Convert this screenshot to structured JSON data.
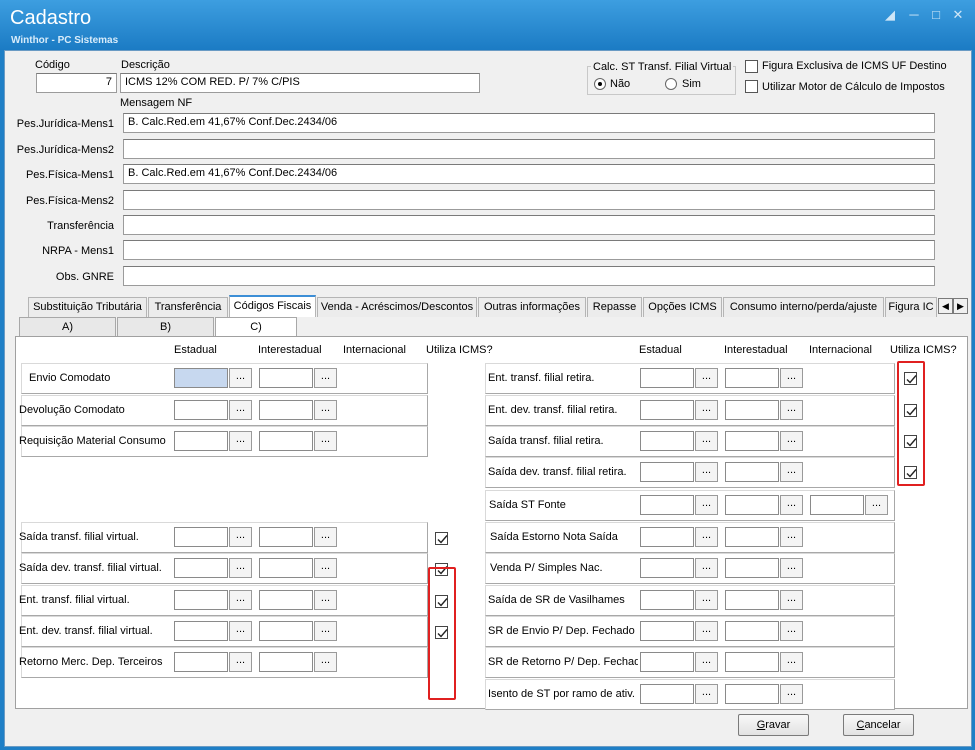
{
  "window": {
    "title": "Cadastro",
    "subtitle": "Winthor - PC Sistemas"
  },
  "header": {
    "codigo_label": "Código",
    "codigo_value": "7",
    "descricao_label": "Descrição",
    "descricao_value": "ICMS 12% COM RED. P/ 7% C/PIS",
    "calc_st_label": "Calc. ST Transf. Filial Virtual",
    "radio_nao": "Não",
    "radio_sim": "Sim",
    "figura_exclusiva": "Figura Exclusiva de ICMS UF Destino",
    "utilizar_motor": "Utilizar Motor de Cálculo de Impostos",
    "mensagem_nf_label": "Mensagem NF"
  },
  "messages": [
    {
      "label": "Pes.Jurídica-Mens1",
      "value": "B. Calc.Red.em 41,67% Conf.Dec.2434/06"
    },
    {
      "label": "Pes.Jurídica-Mens2",
      "value": ""
    },
    {
      "label": "Pes.Física-Mens1",
      "value": "B. Calc.Red.em 41,67% Conf.Dec.2434/06"
    },
    {
      "label": "Pes.Física-Mens2",
      "value": ""
    },
    {
      "label": "Transferência",
      "value": ""
    },
    {
      "label": "NRPA - Mens1",
      "value": ""
    },
    {
      "label": "Obs. GNRE",
      "value": ""
    }
  ],
  "tabs": [
    {
      "label": "Substituição Tributária"
    },
    {
      "label": "Transferência"
    },
    {
      "label": "Códigos Fiscais"
    },
    {
      "label": "Venda - Acréscimos/Descontos"
    },
    {
      "label": "Outras informações"
    },
    {
      "label": "Repasse"
    },
    {
      "label": "Opções ICMS"
    },
    {
      "label": "Consumo interno/perda/ajuste"
    },
    {
      "label": "Figura IC"
    }
  ],
  "subtabs": [
    {
      "label": "A)"
    },
    {
      "label": "B)"
    },
    {
      "label": "C)"
    }
  ],
  "columns": {
    "estadual": "Estadual",
    "interestadual": "Interestadual",
    "internacional": "Internacional",
    "utiliza_icms": "Utiliza ICMS?",
    "dots": "..."
  },
  "left_rows": [
    {
      "label": "Envio Comodato"
    },
    {
      "label": "Devolução Comodato"
    },
    {
      "label": "Requisição Material Consumo"
    },
    {
      "label": "Saída transf. filial virtual."
    },
    {
      "label": "Saída dev. transf. filial virtual."
    },
    {
      "label": "Ent. transf. filial virtual."
    },
    {
      "label": "Ent. dev. transf. filial virtual."
    },
    {
      "label": "Retorno Merc. Dep. Terceiros"
    }
  ],
  "right_rows": [
    {
      "label": "Ent. transf. filial retira."
    },
    {
      "label": "Ent. dev. transf. filial retira."
    },
    {
      "label": "Saída transf. filial retira."
    },
    {
      "label": "Saída dev. transf. filial retira."
    },
    {
      "label": "Saída ST Fonte"
    },
    {
      "label": "Saída Estorno Nota Saída"
    },
    {
      "label": "Venda P/ Simples Nac."
    },
    {
      "label": "Saída de SR de Vasilhames"
    },
    {
      "label": "SR de Envio P/ Dep. Fechado"
    },
    {
      "label": "SR de Retorno P/ Dep. Fechado"
    },
    {
      "label": "Isento de ST por ramo de ativ."
    }
  ],
  "buttons": {
    "gravar_first": "G",
    "gravar_rest": "ravar",
    "cancelar_first": "C",
    "cancelar_rest": "ancelar"
  },
  "colors": {
    "titlebar": "#1f7fc6",
    "highlight": "#e02020",
    "active_tab": "#3c8ed6"
  }
}
